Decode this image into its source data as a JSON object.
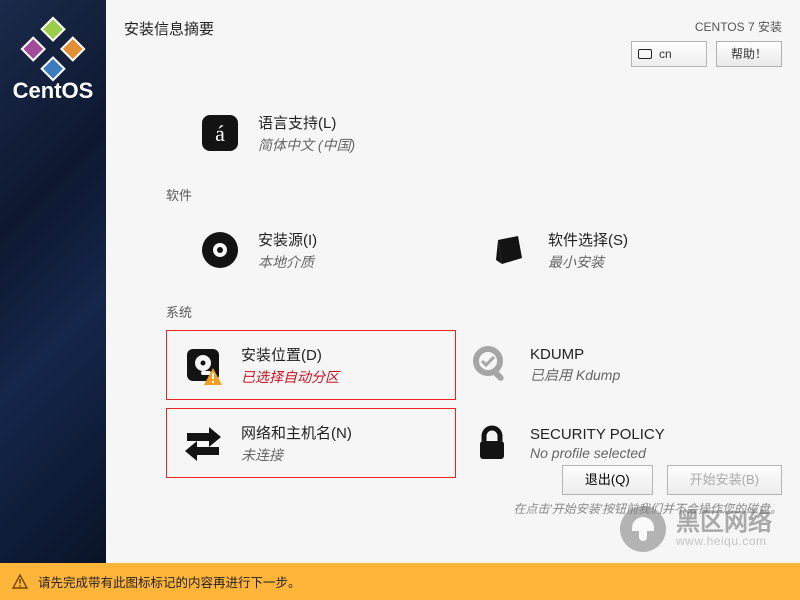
{
  "header": {
    "title": "安装信息摘要",
    "install_label": "CENTOS 7 安装"
  },
  "keyboard": {
    "code": "cn"
  },
  "help": {
    "label": "帮助！"
  },
  "sections": {
    "software": "软件",
    "system": "系统"
  },
  "spokes": {
    "lang": {
      "title": "语言支持(L)",
      "sub": "简体中文 (中国)"
    },
    "source": {
      "title": "安装源(I)",
      "sub": "本地介质"
    },
    "swsel": {
      "title": "软件选择(S)",
      "sub": "最小安装"
    },
    "dest": {
      "title": "安装位置(D)",
      "sub": "已选择自动分区"
    },
    "kdump": {
      "title": "KDUMP",
      "sub": "已启用 Kdump"
    },
    "net": {
      "title": "网络和主机名(N)",
      "sub": "未连接"
    },
    "secpol": {
      "title": "SECURITY POLICY",
      "sub": "No profile selected"
    }
  },
  "buttons": {
    "quit": "退出(Q)",
    "begin": "开始安装(B)"
  },
  "footer_note": "在点击'开始安装'按钮前我们并不会操作您的磁盘。",
  "warning": "请先完成带有此图标标记的内容再进行下一步。",
  "brand": "CentOS",
  "watermark": {
    "zh": "黑区网络",
    "en": "www.heiqu.com"
  }
}
